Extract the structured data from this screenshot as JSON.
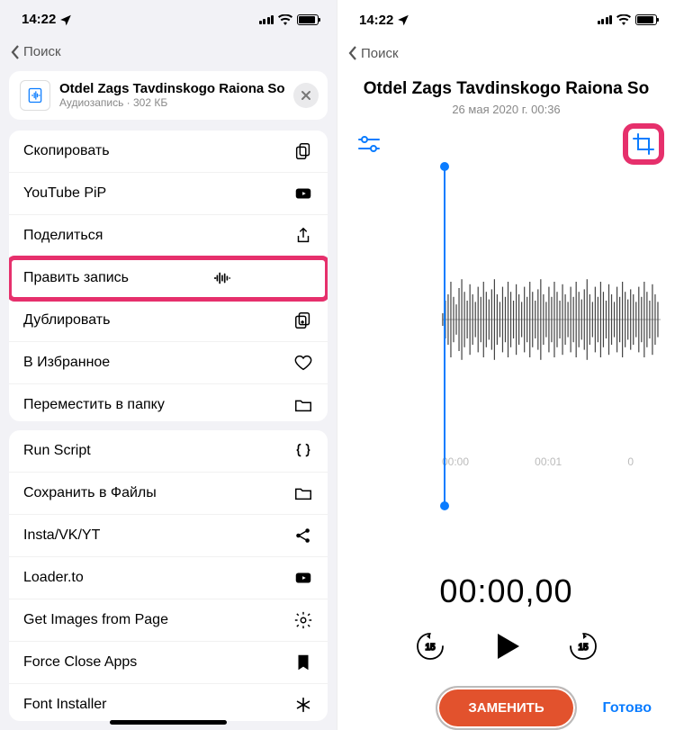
{
  "status": {
    "time": "14:22",
    "search_label": "Поиск"
  },
  "left": {
    "header": {
      "title": "Otdel Zags Tavdinskogo Raiona So",
      "subtitle": "Аудиозапись · 302 КБ"
    },
    "group1": [
      {
        "label": "Скопировать",
        "icon": "copy"
      },
      {
        "label": "YouTube PiP",
        "icon": "youtube"
      },
      {
        "label": "Поделиться",
        "icon": "share"
      },
      {
        "label": "Править запись",
        "icon": "waveform",
        "highlight": true
      },
      {
        "label": "Дублировать",
        "icon": "duplicate"
      },
      {
        "label": "В Избранное",
        "icon": "heart"
      },
      {
        "label": "Переместить в папку",
        "icon": "folder"
      }
    ],
    "group2": [
      {
        "label": "Run Script",
        "icon": "braces"
      },
      {
        "label": "Сохранить в Файлы",
        "icon": "folder"
      },
      {
        "label": "Insta/VK/YT",
        "icon": "share2"
      },
      {
        "label": "Loader.to",
        "icon": "youtube"
      },
      {
        "label": "Get Images from Page",
        "icon": "gear"
      },
      {
        "label": "Force Close Apps",
        "icon": "bookmark"
      },
      {
        "label": "Font Installer",
        "icon": "asterisk"
      }
    ]
  },
  "right": {
    "title": "Otdel Zags Tavdinskogo Raiona So",
    "subtitle": "26 мая 2020 г.  00:36",
    "ticks": {
      "t0": "00:00",
      "t1": "00:01",
      "t2": "0"
    },
    "playtime": "00:00,00",
    "replace": "ЗАМЕНИТЬ",
    "done": "Готово",
    "skip": "15"
  },
  "colors": {
    "accent": "#0a7cff",
    "highlight": "#e6306c",
    "replace": "#e2522d"
  }
}
